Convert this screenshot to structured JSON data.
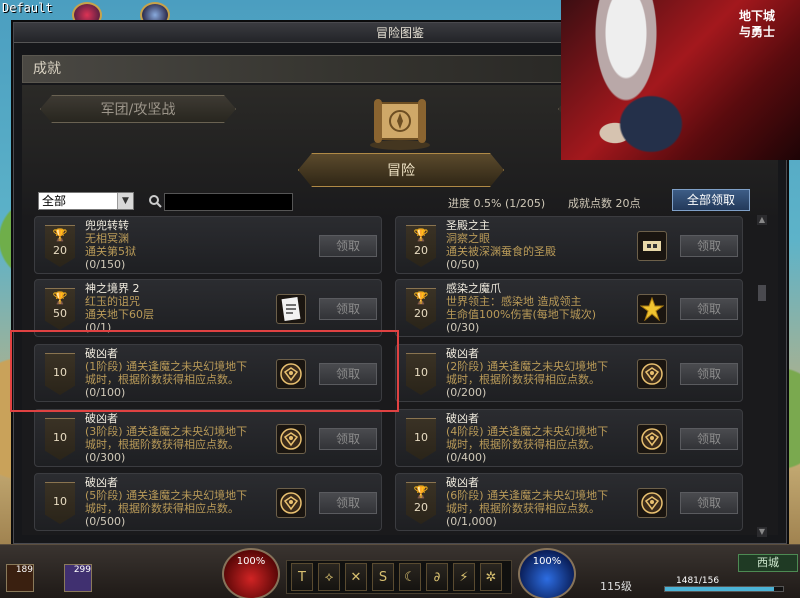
{
  "overlay_label": "Default",
  "window": {
    "title": "冒险图鉴",
    "section_header": "成就",
    "tabs": {
      "legion": "军团/攻坚战",
      "adventure": "冒险"
    }
  },
  "filter": {
    "selected": "全部",
    "search_placeholder": "",
    "progress": "进度  0.5% (1/205)",
    "points": "成就点数 20点",
    "claim_all": "全部领取"
  },
  "cards": [
    {
      "points": "20",
      "trophy": true,
      "title": "兜兜转转",
      "line1": "无相冥渊",
      "line2": "通关第5狱",
      "progress": "(0/150)",
      "reward": false,
      "claim": "领取"
    },
    {
      "points": "20",
      "trophy": true,
      "title": "圣殿之主",
      "line1": "洞察之眼",
      "line2": "通关被深渊蚕食的圣殿",
      "progress": "(0/50)",
      "reward": true,
      "claim": "领取"
    },
    {
      "points": "50",
      "trophy": true,
      "title": "神之境界 2",
      "line1": "红玉的诅咒",
      "line2": "通关地下60层",
      "progress": "(0/1)",
      "reward": true,
      "claim": "领取"
    },
    {
      "points": "20",
      "trophy": true,
      "title": "感染之魔爪",
      "line1": "世界领主：感染地      造成领主",
      "line2": "生命值100%伤害(每地下城次)",
      "progress": "(0/30)",
      "reward": true,
      "claim": "领取"
    },
    {
      "points": "10",
      "trophy": false,
      "title": "破凶者",
      "line1": "(1阶段) 通关逢魔之未央幻境地下",
      "line2": "城时，根据阶数获得相应点数。",
      "progress": "(0/100)",
      "reward": true,
      "claim": "领取"
    },
    {
      "points": "10",
      "trophy": false,
      "title": "破凶者",
      "line1": "(2阶段) 通关逢魔之未央幻境地下",
      "line2": "城时，根据阶数获得相应点数。",
      "progress": "(0/200)",
      "reward": true,
      "claim": "领取"
    },
    {
      "points": "10",
      "trophy": false,
      "title": "破凶者",
      "line1": "(3阶段) 通关逢魔之未央幻境地下",
      "line2": "城时，根据阶数获得相应点数。",
      "progress": "(0/300)",
      "reward": true,
      "claim": "领取"
    },
    {
      "points": "10",
      "trophy": false,
      "title": "破凶者",
      "line1": "(4阶段) 通关逢魔之未央幻境地下",
      "line2": "城时，根据阶数获得相应点数。",
      "progress": "(0/400)",
      "reward": true,
      "claim": "领取"
    },
    {
      "points": "10",
      "trophy": false,
      "title": "破凶者",
      "line1": "(5阶段) 通关逢魔之未央幻境地下",
      "line2": "城时，根据阶数获得相应点数。",
      "progress": "(0/500)",
      "reward": true,
      "claim": "领取"
    },
    {
      "points": "20",
      "trophy": true,
      "title": "破凶者",
      "line1": "(6阶段) 通关逢魔之未央幻境地下",
      "line2": "城时，根据阶数获得相应点数。",
      "progress": "(0/1,000)",
      "reward": true,
      "claim": "领取"
    }
  ],
  "ad": {
    "logo_line1": "地下城",
    "logo_line2": "与勇士"
  },
  "hud": {
    "hp": "100%",
    "mp": "100%",
    "item1_count": "189",
    "item2_count": "299",
    "level": "115级",
    "town": "西城",
    "exp": "1481/156",
    "skills": [
      "T",
      "⟡",
      "✕",
      "S",
      "☾",
      "∂",
      "⚡",
      "✲"
    ]
  },
  "colors": {
    "accent_blue": "#3d5d86",
    "highlight_red": "#e04242",
    "gold_text": "#b99a58"
  }
}
